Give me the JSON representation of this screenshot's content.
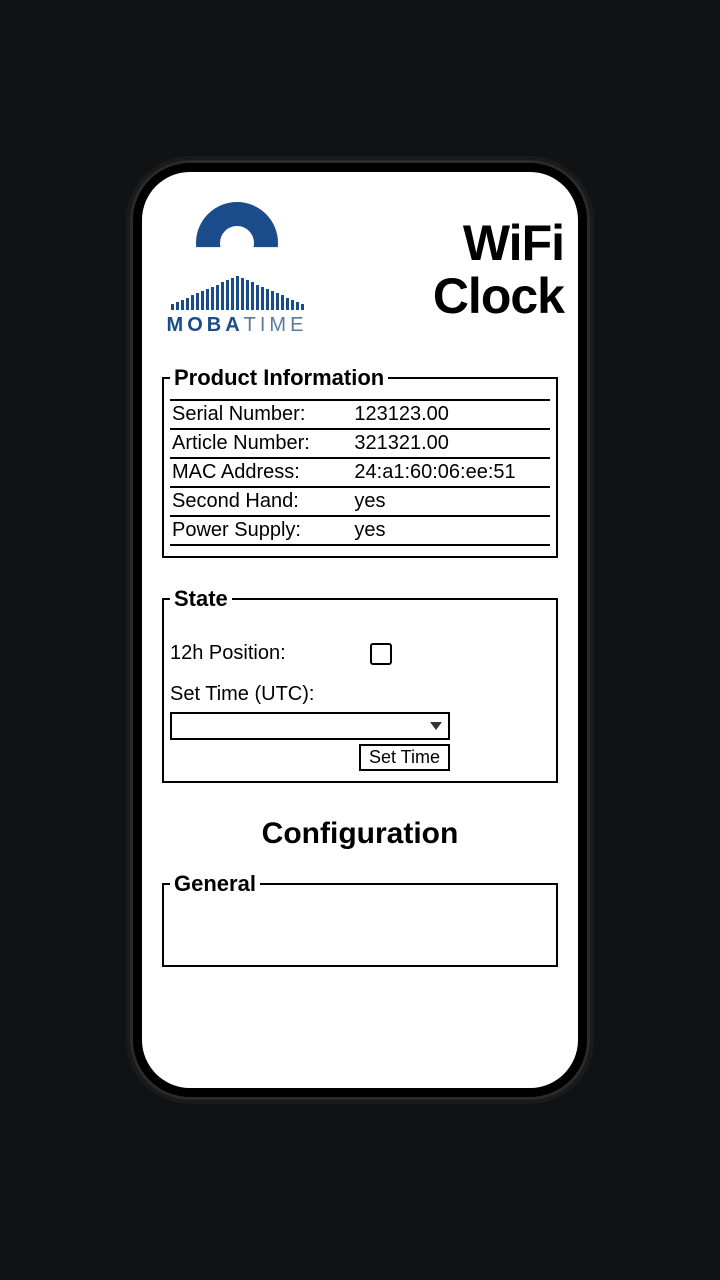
{
  "brand": {
    "part1": "MOBA",
    "part2": "TIME"
  },
  "title": {
    "line1": "WiFi",
    "line2": "Clock"
  },
  "product": {
    "legend": "Product Information",
    "rows": [
      {
        "label": "Serial Number:",
        "value": "123123.00"
      },
      {
        "label": "Article Number:",
        "value": "321321.00"
      },
      {
        "label": "MAC Address:",
        "value": "24:a1:60:06:ee:51"
      },
      {
        "label": "Second Hand:",
        "value": "yes"
      },
      {
        "label": "Power Supply:",
        "value": "yes"
      }
    ]
  },
  "state": {
    "legend": "State",
    "pos_label": "12h Position:",
    "pos_checked": false,
    "set_time_label": "Set Time (UTC):",
    "dropdown_value": "",
    "button": "Set Time"
  },
  "config_heading": "Configuration",
  "general": {
    "legend": "General"
  }
}
